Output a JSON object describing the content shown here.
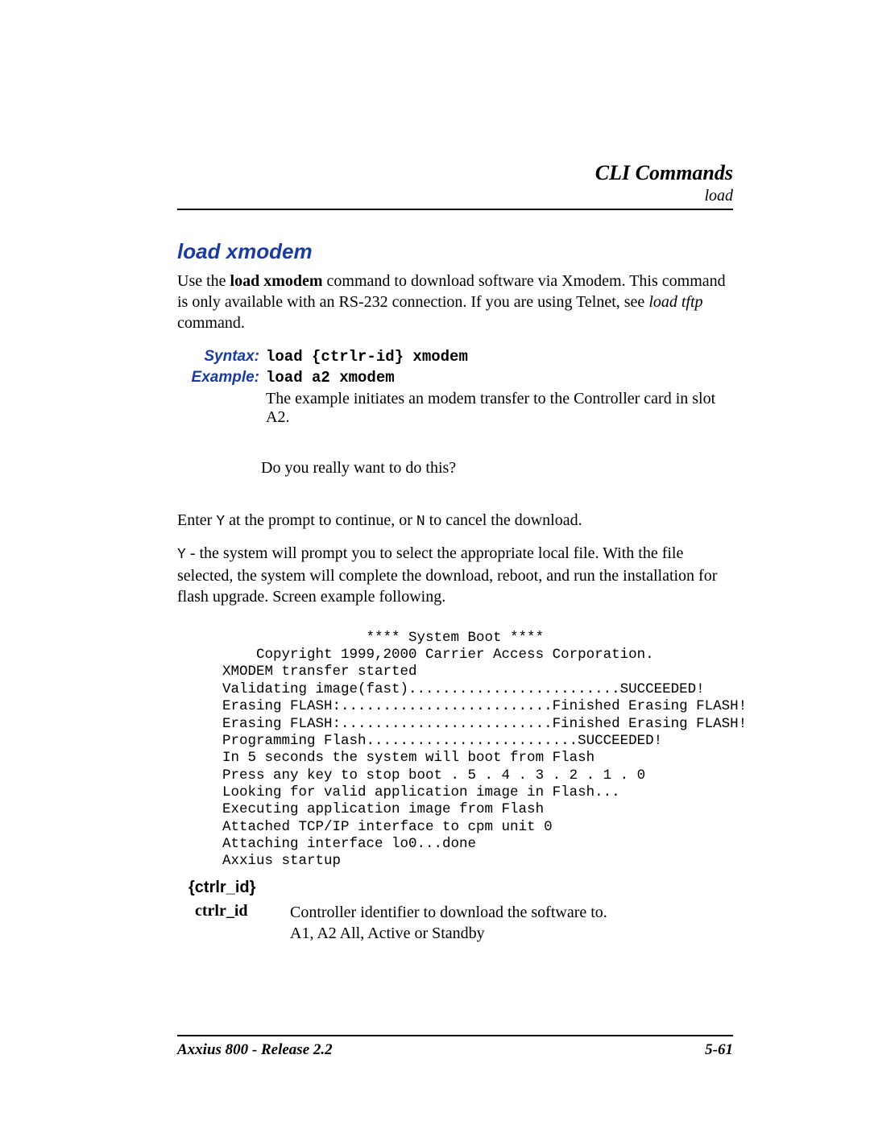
{
  "header": {
    "title": "CLI Commands",
    "subtitle": "load"
  },
  "section": {
    "title": "load xmodem",
    "intro_part1": "Use the ",
    "intro_bold": "load xmodem",
    "intro_part2": " command to download software via Xmodem. This command is only available with an RS-232 connection. If you are using Telnet, see ",
    "intro_italic": "load tftp",
    "intro_part3": " command."
  },
  "syntax": {
    "label": "Syntax:",
    "value": "load {ctrlr-id} xmodem"
  },
  "example": {
    "label": "Example:",
    "value": "load a2 xmodem",
    "desc": "The example initiates an modem transfer to the Controller card in slot A2."
  },
  "prompt_text": "Do you really want to do this?",
  "enter_para": {
    "p1": "Enter ",
    "m1": "Y",
    "p2": " at the prompt to continue, or ",
    "m2": "N",
    "p3": " to cancel the download."
  },
  "y_para": {
    "m1": " Y",
    "p1": " - the system will prompt you to select the appropriate local file. With the file selected, the system will complete the download, reboot, and run the installation for flash upgrade. Screen example following."
  },
  "system_boot": "                 **** System Boot ****\n    Copyright 1999,2000 Carrier Access Corporation.\nXMODEM transfer started\nValidating image(fast).........................SUCCEEDED!\nErasing FLASH:.........................Finished Erasing FLASH!\nErasing FLASH:.........................Finished Erasing FLASH!\nProgramming Flash.........................SUCCEEDED!\nIn 5 seconds the system will boot from Flash\nPress any key to stop boot . 5 . 4 . 3 . 2 . 1 . 0\nLooking for valid application image in Flash...\nExecuting application image from Flash\nAttached TCP/IP interface to cpm unit 0\nAttaching interface lo0...done\nAxxius startup",
  "param": {
    "heading": "{ctrlr_id}",
    "name": "ctrlr_id",
    "desc_line1": "Controller identifier to download the software to.",
    "desc_line2": "A1, A2 All, Active or Standby"
  },
  "footer": {
    "left": "Axxius 800 - Release 2.2",
    "right": "5-61"
  }
}
